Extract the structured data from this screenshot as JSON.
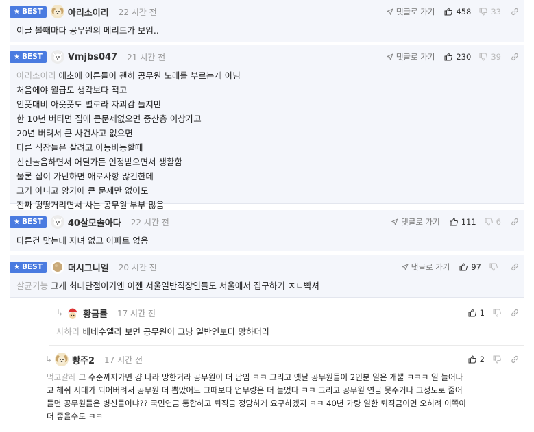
{
  "labels": {
    "best": "BEST",
    "reply_to": "댓글로 가기"
  },
  "colors": {
    "best_bg": "#f4f6fb",
    "badge": "#4a7be0",
    "mention": "#aaaaaa"
  },
  "comments": [
    {
      "best": true,
      "avatar": "puppy-avatar-icon",
      "nick": "아리소이리",
      "time": "22 시간 전",
      "up": "458",
      "down": "33",
      "mention": "",
      "lines": [
        "이글 볼때마다 공무원의 메리트가 보임.."
      ]
    },
    {
      "best": true,
      "avatar": "white-dog-avatar-icon",
      "nick": "Vmjbs047",
      "time": "21 시간 전",
      "up": "230",
      "down": "39",
      "mention": "아리소이리",
      "lines": [
        "애초에 어른들이 괜히 공무원 노래를 부르는게 아님",
        "처음에야 월급도 생각보다 적고",
        "인풋대비 아웃풋도 별로라 자괴감 들지만",
        "한 10년 버티면 집에 큰문제없으면 중산층 이상가고",
        "20년 버텨서 큰 사건사고 없으면",
        "다른 직장들은 살려고 아등바등할때",
        "신선놀음하면서 어딜가든 인정받으면서 생활함",
        "물론 집이 가난하면 애로사항 많긴한데",
        "그거 아니고 양가에 큰 문제만 없어도",
        "진짜 떵떵거리면서 사는 공무원 부부 많음"
      ]
    },
    {
      "best": true,
      "avatar": "white-dog-avatar-icon",
      "nick": "40살모솔아다",
      "time": "22 시간 전",
      "up": "111",
      "down": "6",
      "mention": "",
      "lines": [
        "다른건 맞는데 자녀 없고 아파트 없음"
      ]
    },
    {
      "best": true,
      "avatar": "brown-circle-avatar-icon",
      "nick": "더시그니엘",
      "time": "20 시간 전",
      "up": "97",
      "down": "",
      "mention": "살균기능",
      "lines": [
        "그게 최대단점이기엔 이젠 서울일반직장인들도 서울에서 집구하기 ㅈㄴ빡셔"
      ]
    },
    {
      "best": false,
      "avatar": "santa-avatar-icon",
      "nick": "황금률",
      "time": "17 시간 전",
      "up": "1",
      "down": "",
      "mention": "사하라",
      "lines": [
        "베네수엘라 보면 공무원이 그냥 일반인보다 망하더라"
      ]
    },
    {
      "best": false,
      "avatar": "puppy-avatar-icon",
      "nick": "빵주2",
      "time": "17 시간 전",
      "up": "2",
      "down": "",
      "mention": "먹고갈레",
      "lines": [
        "그 수준까지가면 걍 나라 망한거라 공무원이 더 답임 ㅋㅋ 그리고 옛날 공무원들이 2인분 일은 개뿔 ㅋㅋㅋ 일 늘어나",
        "고 해줘 시대가 되어버려서 공무원 더 뽑았어도 그때보다 업무량은 더 늘었다 ㅋㅋ 그리고 공무원 연금 못주거나 그정도로 줄어",
        "들면 공무원들은 병신들이냐?? 국민연금 통합하고 퇴직금 정당하게 요구하겠지 ㅋㅋ 40년 가량 일한 퇴직금이면 오히려 이쪽이",
        "더 좋을수도 ㅋㅋ"
      ]
    }
  ]
}
